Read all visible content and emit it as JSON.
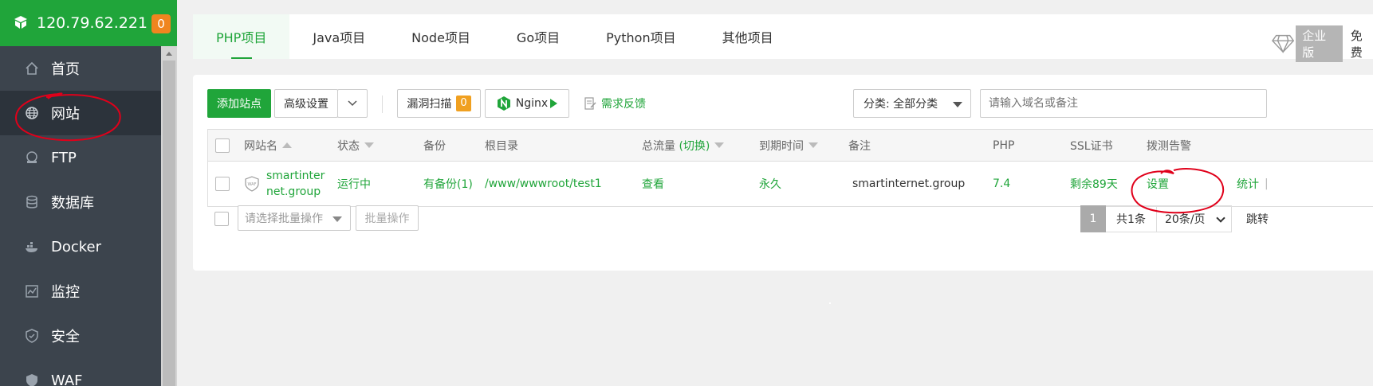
{
  "sidebar": {
    "ip": "120.79.62.221",
    "badge": "0",
    "items": [
      {
        "label": "首页",
        "icon": "home-icon"
      },
      {
        "label": "网站",
        "icon": "globe-icon"
      },
      {
        "label": "FTP",
        "icon": "ftp-icon"
      },
      {
        "label": "数据库",
        "icon": "database-icon"
      },
      {
        "label": "Docker",
        "icon": "docker-icon"
      },
      {
        "label": "监控",
        "icon": "monitor-icon"
      },
      {
        "label": "安全",
        "icon": "shield-icon"
      },
      {
        "label": "WAF",
        "icon": "waf-icon"
      }
    ]
  },
  "tabs": [
    "PHP项目",
    "Java项目",
    "Node项目",
    "Go项目",
    "Python项目",
    "其他项目"
  ],
  "enterprise": {
    "label": "企业版",
    "free": "免费"
  },
  "toolbar": {
    "add_site": "添加站点",
    "advanced": "高级设置",
    "vuln_scan": "漏洞扫描",
    "vuln_count": "0",
    "nginx": "Nginx",
    "feedback": "需求反馈",
    "category": "分类: 全部分类",
    "search_placeholder": "请输入域名或备注"
  },
  "table": {
    "headers": {
      "name": "网站名",
      "status": "状态",
      "backup": "备份",
      "root": "根目录",
      "traffic": "总流量",
      "traffic_switch": "(切换)",
      "expire": "到期时间",
      "remark": "备注",
      "php": "PHP",
      "ssl": "SSL证书",
      "probe": "拨测告警"
    },
    "rows": [
      {
        "name_line1": "smartinter",
        "name_line2": "net.group",
        "status": "运行中",
        "backup": "有备份(1)",
        "root": "/www/wwwroot/test1",
        "traffic": "查看",
        "expire": "永久",
        "remark": "smartinternet.group",
        "php": "7.4",
        "ssl": "剩余89天",
        "probe": "设置",
        "stats": "统计"
      }
    ]
  },
  "bottom": {
    "batch_placeholder": "请选择批量操作",
    "batch_button": "批量操作",
    "page": "1",
    "total": "共1条",
    "page_size": "20条/页",
    "jump": "跳转"
  },
  "colors": {
    "brand": "#20a53a",
    "sidebar": "#3c444d",
    "annotation": "#e0001a"
  }
}
